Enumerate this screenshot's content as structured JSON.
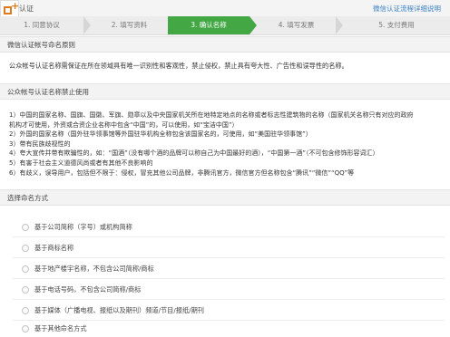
{
  "header": {
    "title": "认证",
    "help_link": "微信认证流程详细说明"
  },
  "steps": [
    {
      "label": "1. 同意协议",
      "active": false
    },
    {
      "label": "2. 填写资料",
      "active": false
    },
    {
      "label": "3. 确认名称",
      "active": true
    },
    {
      "label": "4. 填写发票",
      "active": false
    },
    {
      "label": "5. 支付费用",
      "active": false
    }
  ],
  "sections": {
    "principle_title": "微信认证帐号命名原则",
    "principle_text": "公众帐号认证名称需保证在所在领域具有唯一识别性和客观性，禁止侵权，禁止具有夸大性、广告性和误导性的名称。",
    "forbidden_title": "公众帐号认证名称禁止使用",
    "forbidden_items": [
      "1）中国的国家名称、国旗、国徽、军旗、勋章以及中央国家机关所在地特定地点的名称或者标志性建筑物的名称（国家机关名称只有对应的政府",
      "机构才可使用，外资或合资企业名称中包含“中国”的，可以使用，如“宝洁中国”）",
      "2）外国的国家名称（国外驻华领事馆等外国驻华机构全称包含该国家名的，可使用，如“美国驻华领事馆”）",
      "3）带有民族歧视性的",
      "4）夸大宣传并带有欺骗性的，如：“国酒”（没有哪个酒的品牌可以称自己为中国最好的酒），“中国第一酒”（不可包含修饰形容词汇）",
      "5）有害于社会主义道德风尚或者有其他不良影响的",
      "6）有歧义，误导用户，包括但不限于：侵权，冒充其他公司品牌，非腾讯官方，微信官方但名称包含“腾讯”“微信”“QQ”等"
    ],
    "choose_title": "选择命名方式"
  },
  "options": [
    "基于公司简称（字号）或机构简称",
    "基于商标名称",
    "基于地产楼宇名称，不包含公司简称/商标",
    "基于电话号码，不包含公司简称/商标",
    "基于媒体（广播电视、报纸以及期刊）频道/节目/报纸/期刊",
    "基于其他命名方式"
  ]
}
